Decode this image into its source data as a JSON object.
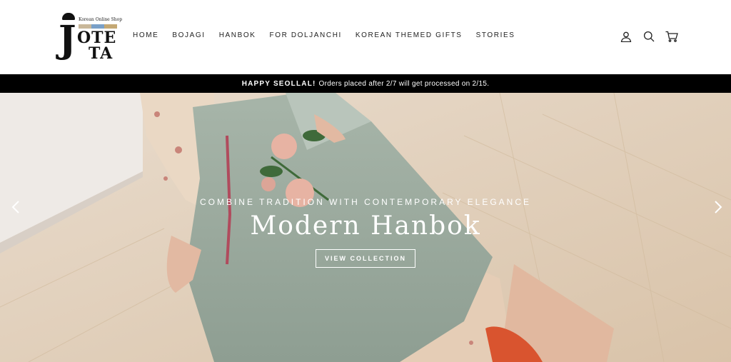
{
  "logo": {
    "tagline": "Korean Online Shop",
    "letter_j": "J",
    "letters_ote": "OTE",
    "letters_ta": "TA",
    "bar_colors": [
      "#c9b89a",
      "#7aa0c8",
      "#c4a874"
    ]
  },
  "nav": {
    "items": [
      "HOME",
      "BOJAGI",
      "HANBOK",
      "FOR DOLJANCHI",
      "KOREAN THEMED GIFTS",
      "STORIES"
    ]
  },
  "header_icons": [
    "account-icon",
    "search-icon",
    "cart-icon"
  ],
  "announcement": {
    "highlight": "HAPPY SEOLLAL!",
    "message": "Orders placed after 2/7 will get processed on 2/15."
  },
  "hero": {
    "subtitle": "COMBINE TRADITION WITH CONTEMPORARY ELEGANCE",
    "title": "Modern Hanbok",
    "button": "VIEW COLLECTION",
    "prev_icon": "chevron-left-icon",
    "next_icon": "chevron-right-icon"
  }
}
